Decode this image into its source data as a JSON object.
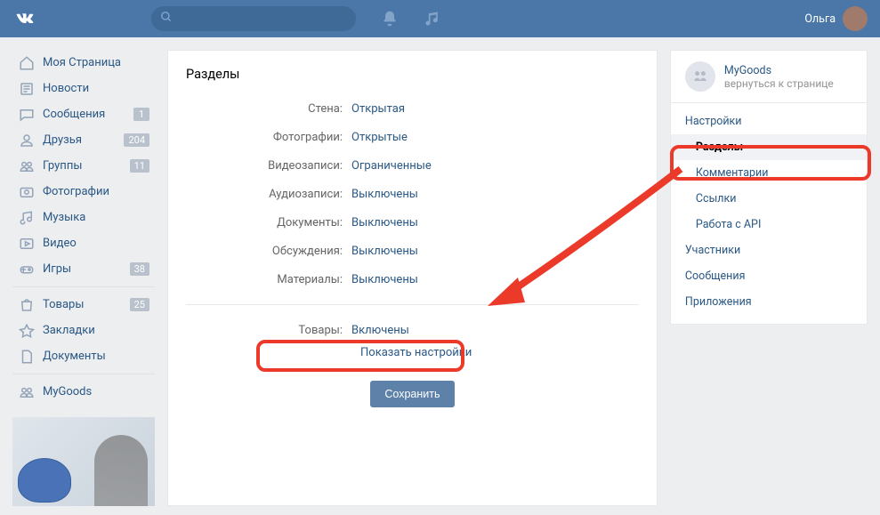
{
  "header": {
    "user_name": "Ольга"
  },
  "leftnav": {
    "items": [
      {
        "icon": "home",
        "label": "Моя Страница",
        "badge": null
      },
      {
        "icon": "news",
        "label": "Новости",
        "badge": null
      },
      {
        "icon": "msg",
        "label": "Сообщения",
        "badge": "1"
      },
      {
        "icon": "friends",
        "label": "Друзья",
        "badge": "204"
      },
      {
        "icon": "groups",
        "label": "Группы",
        "badge": "11"
      },
      {
        "icon": "photo",
        "label": "Фотографии",
        "badge": null
      },
      {
        "icon": "music",
        "label": "Музыка",
        "badge": null
      },
      {
        "icon": "video",
        "label": "Видео",
        "badge": null
      },
      {
        "icon": "games",
        "label": "Игры",
        "badge": "38"
      }
    ],
    "items2": [
      {
        "icon": "market",
        "label": "Товары",
        "badge": "25"
      },
      {
        "icon": "fav",
        "label": "Закладки",
        "badge": null
      },
      {
        "icon": "docs",
        "label": "Документы",
        "badge": null
      }
    ],
    "items3": [
      {
        "icon": "group",
        "label": "MyGoods",
        "badge": null
      }
    ]
  },
  "main": {
    "title": "Разделы",
    "rows": [
      {
        "label": "Стена:",
        "value": "Открытая"
      },
      {
        "label": "Фотографии:",
        "value": "Открытые"
      },
      {
        "label": "Видеозаписи:",
        "value": "Ограниченные"
      },
      {
        "label": "Аудиозаписи:",
        "value": "Выключены"
      },
      {
        "label": "Документы:",
        "value": "Выключены"
      },
      {
        "label": "Обсуждения:",
        "value": "Выключены"
      },
      {
        "label": "Материалы:",
        "value": "Выключены"
      }
    ],
    "goods_row": {
      "label": "Товары:",
      "value": "Включены"
    },
    "show_settings": "Показать настройки",
    "save": "Сохранить"
  },
  "right": {
    "group_name": "MyGoods",
    "back_text": "вернуться к странице",
    "items": [
      {
        "label": "Настройки",
        "sub": false
      },
      {
        "label": "Разделы",
        "sub": true,
        "active": true
      },
      {
        "label": "Комментарии",
        "sub": true
      },
      {
        "label": "Ссылки",
        "sub": true
      },
      {
        "label": "Работа с API",
        "sub": true
      },
      {
        "label": "Участники",
        "sub": false
      },
      {
        "label": "Сообщения",
        "sub": false
      },
      {
        "label": "Приложения",
        "sub": false
      }
    ]
  }
}
